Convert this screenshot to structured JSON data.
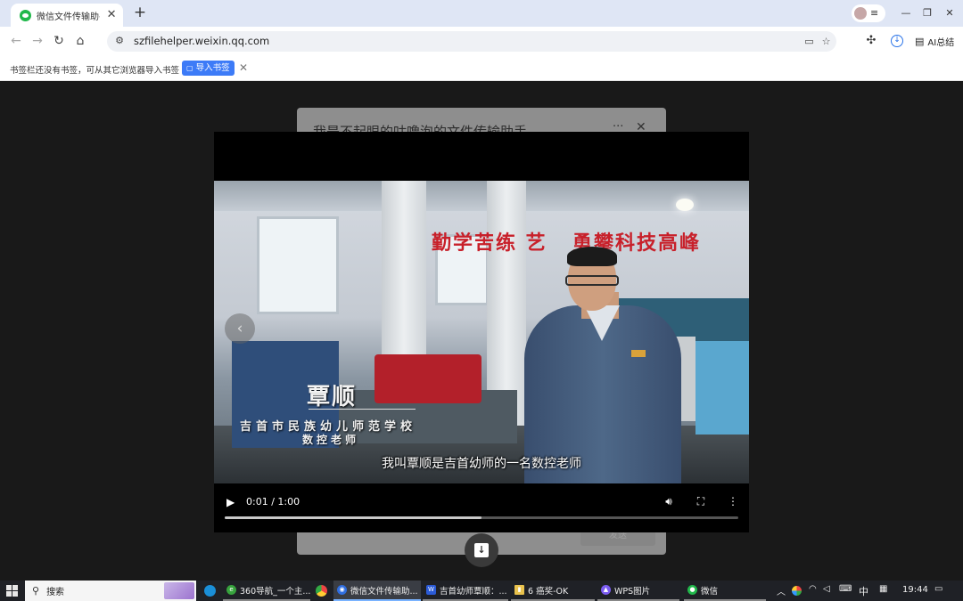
{
  "browser": {
    "tab": {
      "title": "微信文件传输助手",
      "close": "✕"
    },
    "new_tab": "+",
    "window_controls": {
      "minimize": "—",
      "restore": "❐",
      "close": "✕"
    },
    "nav": {
      "back": "←",
      "forward": "→",
      "reload": "↻",
      "home": "⌂"
    },
    "url": "szfilehelper.weixin.qq.com",
    "ai_summary_label": "AI总结"
  },
  "bookmark_bar": {
    "message": "书签栏还没有书签，可从其它浏览器导入书签",
    "import_label": "导入书签",
    "close": "✕"
  },
  "chat": {
    "title": "我是不起眼的咕噜泡的文件传输助手",
    "more": "···",
    "close": "✕",
    "send_label": "发送"
  },
  "video": {
    "name": "覃顺",
    "school": "吉首市民族幼儿师范学校",
    "role": "数控老师",
    "subtitle": "我叫覃顺是吉首幼师的一名数控老师",
    "slogan_left": "勤学苦练 艺",
    "slogan_right": "勇攀科技高峰",
    "time": "0:01 / 1:00",
    "progress": 0.5
  },
  "taskbar": {
    "search_label": "搜索",
    "apps": [
      {
        "label": "360导航_一个主...",
        "color": "#37a33d",
        "glyph": "e"
      },
      {
        "label": "微信文件传输助...",
        "color": "#2f6ee0",
        "glyph": "◉"
      },
      {
        "label": "吉首幼师覃顺：...",
        "color": "#2b5bd7",
        "glyph": "W"
      },
      {
        "label": "6 癌奖-OK",
        "color": "#e9c24d",
        "glyph": "▮"
      },
      {
        "label": "WPS图片",
        "color": "#7b5cf0",
        "glyph": "▲"
      },
      {
        "label": "微信",
        "color": "#21b84b",
        "glyph": "●"
      }
    ],
    "ime": "中",
    "clock": "19:44"
  }
}
